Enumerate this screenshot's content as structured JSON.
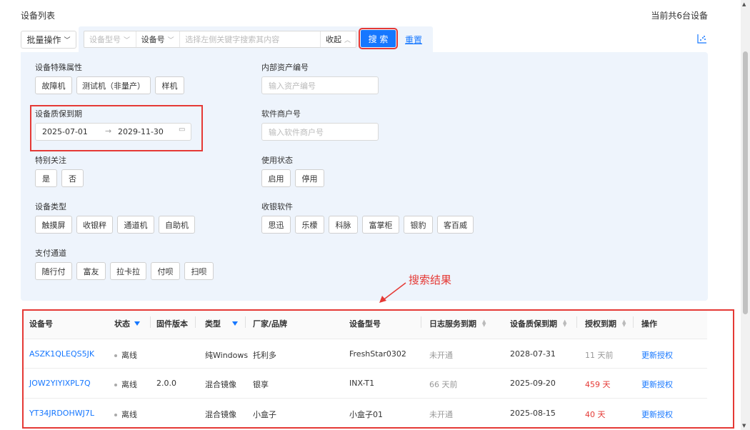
{
  "header": {
    "title": "设备列表",
    "device_count": "当前共6台设备"
  },
  "toolbar": {
    "batch_label": "批量操作",
    "search": {
      "field1": "设备型号",
      "field2": "设备号",
      "placeholder": "选择左侧关键字搜索其内容",
      "collapse_label": "收起"
    },
    "search_button": "搜 索",
    "reset_link": "重置"
  },
  "filters": {
    "special_attr": {
      "label": "设备特殊属性",
      "options": [
        "故障机",
        "测试机（非量产）",
        "样机"
      ]
    },
    "asset_no": {
      "label": "内部资产编号",
      "placeholder": "输入资产编号"
    },
    "warranty": {
      "label": "设备质保到期",
      "start": "2025-07-01",
      "end": "2029-11-30"
    },
    "software_merchant": {
      "label": "软件商户号",
      "placeholder": "输入软件商户号"
    },
    "special_focus": {
      "label": "特别关注",
      "options": [
        "是",
        "否"
      ]
    },
    "usage_status": {
      "label": "使用状态",
      "options": [
        "启用",
        "停用"
      ]
    },
    "device_type": {
      "label": "设备类型",
      "options": [
        "触摸屏",
        "收银秤",
        "通道机",
        "自助机"
      ]
    },
    "pos_software": {
      "label": "收银软件",
      "options": [
        "思迅",
        "乐檬",
        "科脉",
        "富掌柜",
        "银豹",
        "客百威"
      ]
    },
    "payment_channel": {
      "label": "支付通道",
      "options": [
        "随行付",
        "富友",
        "拉卡拉",
        "付呗",
        "扫呗"
      ]
    }
  },
  "annotation": "搜索结果",
  "table": {
    "headers": [
      "设备号",
      "状态",
      "固件版本",
      "类型",
      "厂家/品牌",
      "设备型号",
      "日志服务到期",
      "设备质保到期",
      "授权到期",
      "操作"
    ],
    "rows": [
      {
        "device_no": "ASZK1QLEQS5JK",
        "status": "离线",
        "firmware": "",
        "type": "纯Windows",
        "brand": "托利多",
        "model": "FreshStar0302",
        "log_service": "未开通",
        "warranty": "2028-07-31",
        "license": "11 天前",
        "action": "更新授权"
      },
      {
        "device_no": "JOW2YIYIXPL7Q",
        "status": "离线",
        "firmware": "2.0.0",
        "type": "混合镜像",
        "brand": "银享",
        "model": "INX-T1",
        "log_service": "66 天前",
        "warranty": "2025-09-20",
        "license": "459 天",
        "action": "更新授权"
      },
      {
        "device_no": "YT34JRDOHWJ7L",
        "status": "离线",
        "firmware": "",
        "type": "混合镜像",
        "brand": "小盒子",
        "model": "小盒子01",
        "log_service": "未开通",
        "warranty": "2025-08-15",
        "license": "40 天",
        "action": "更新授权"
      }
    ]
  },
  "colors": {
    "accent": "#1677ff",
    "highlight_red": "#e53935",
    "panel_bg": "#eef4fc"
  }
}
